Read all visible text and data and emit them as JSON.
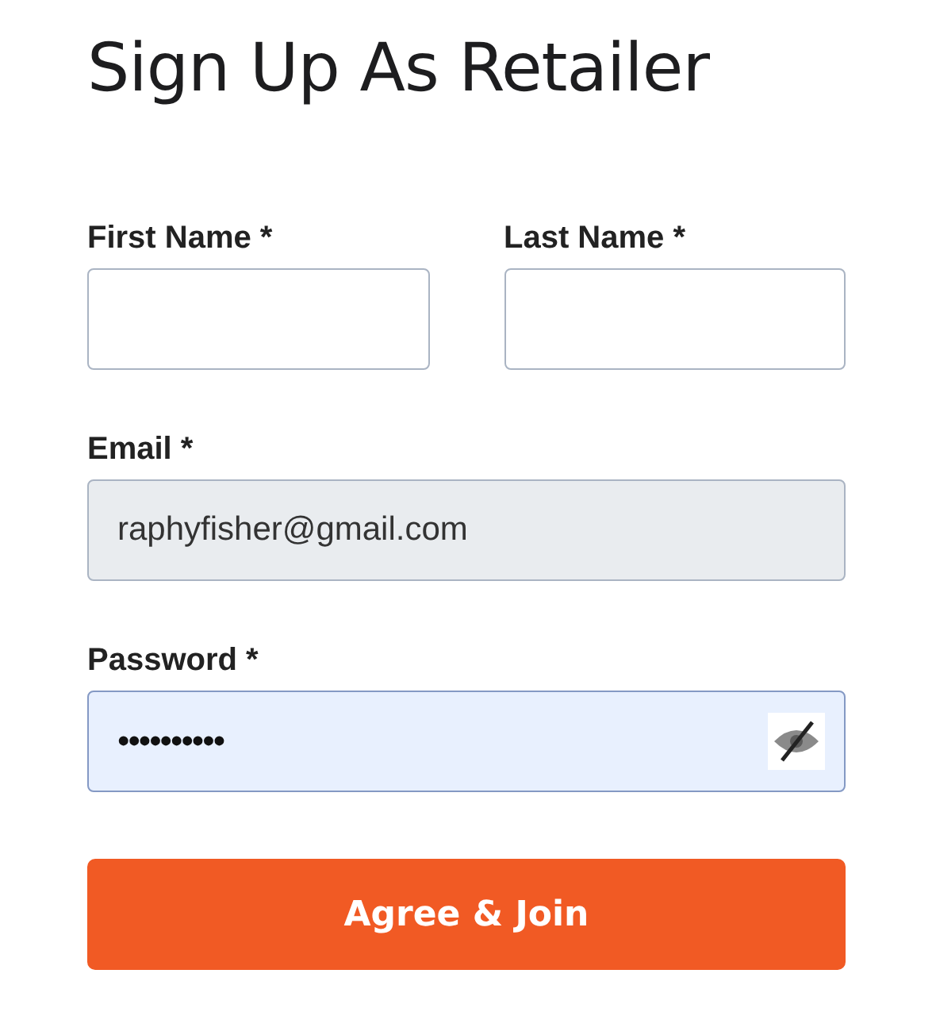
{
  "title": "Sign Up As Retailer",
  "rows": [
    {
      "fields": [
        {
          "label": "First Name *",
          "kind": "text",
          "disabled": false,
          "focused": false
        },
        {
          "label": "Last Name *",
          "kind": "text",
          "disabled": false,
          "focused": false
        }
      ]
    },
    {
      "fields": [
        {
          "label": "Email *",
          "kind": "text",
          "value": "raphyfisher@gmail.com",
          "disabled": true,
          "focused": false
        }
      ]
    },
    {
      "fields": [
        {
          "label": "Password *",
          "kind": "password",
          "value": "••••••••••",
          "disabled": false,
          "focused": true
        }
      ]
    }
  ],
  "submit": "Agree & Join"
}
